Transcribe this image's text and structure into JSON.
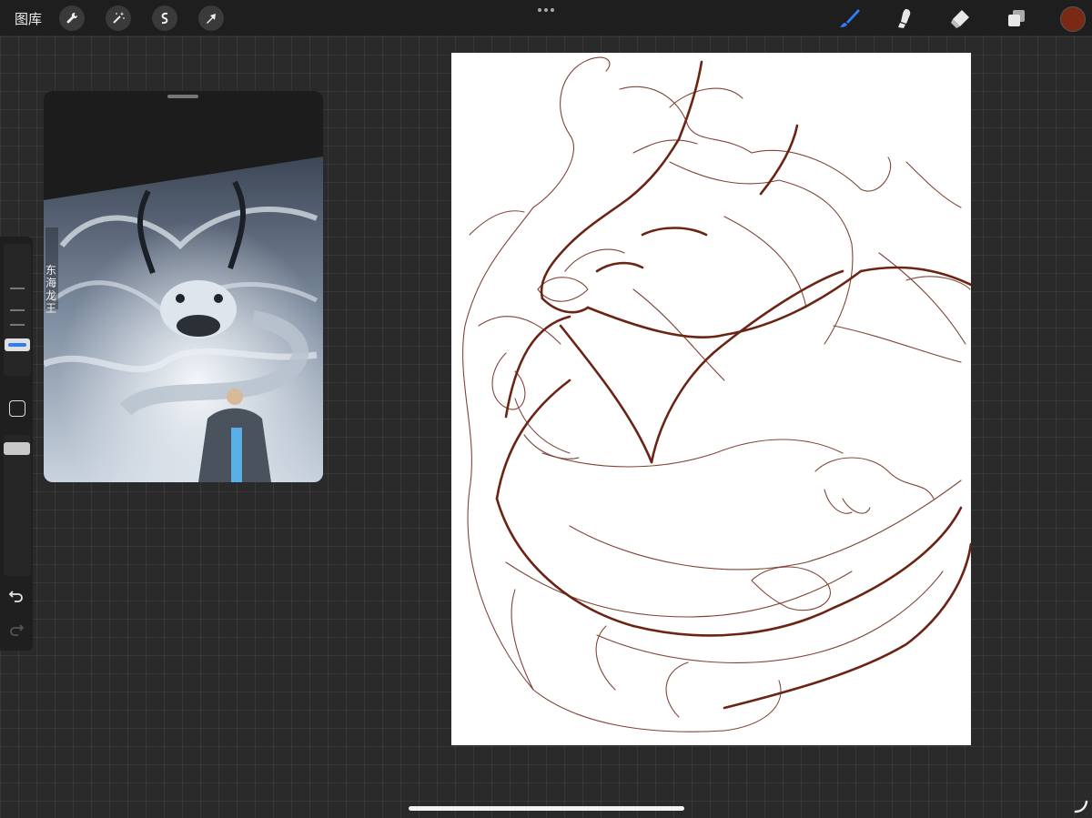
{
  "toolbar": {
    "gallery_label": "图库",
    "left_tools": [
      "wrench-icon",
      "magic-wand-icon",
      "selection-icon",
      "transform-arrow-icon"
    ],
    "right_tools": [
      "brush-icon",
      "smudge-icon",
      "eraser-icon",
      "layers-icon"
    ],
    "active_tool": "brush-icon",
    "current_color": "#7a2a14",
    "accent_color": "#2f7cf6"
  },
  "reference_panel": {
    "caption_vertical": "东海龙王"
  },
  "sidebar": {
    "tools": [
      "brush-size-slider",
      "modify-button",
      "opacity-slider",
      "undo-icon",
      "redo-icon"
    ]
  }
}
